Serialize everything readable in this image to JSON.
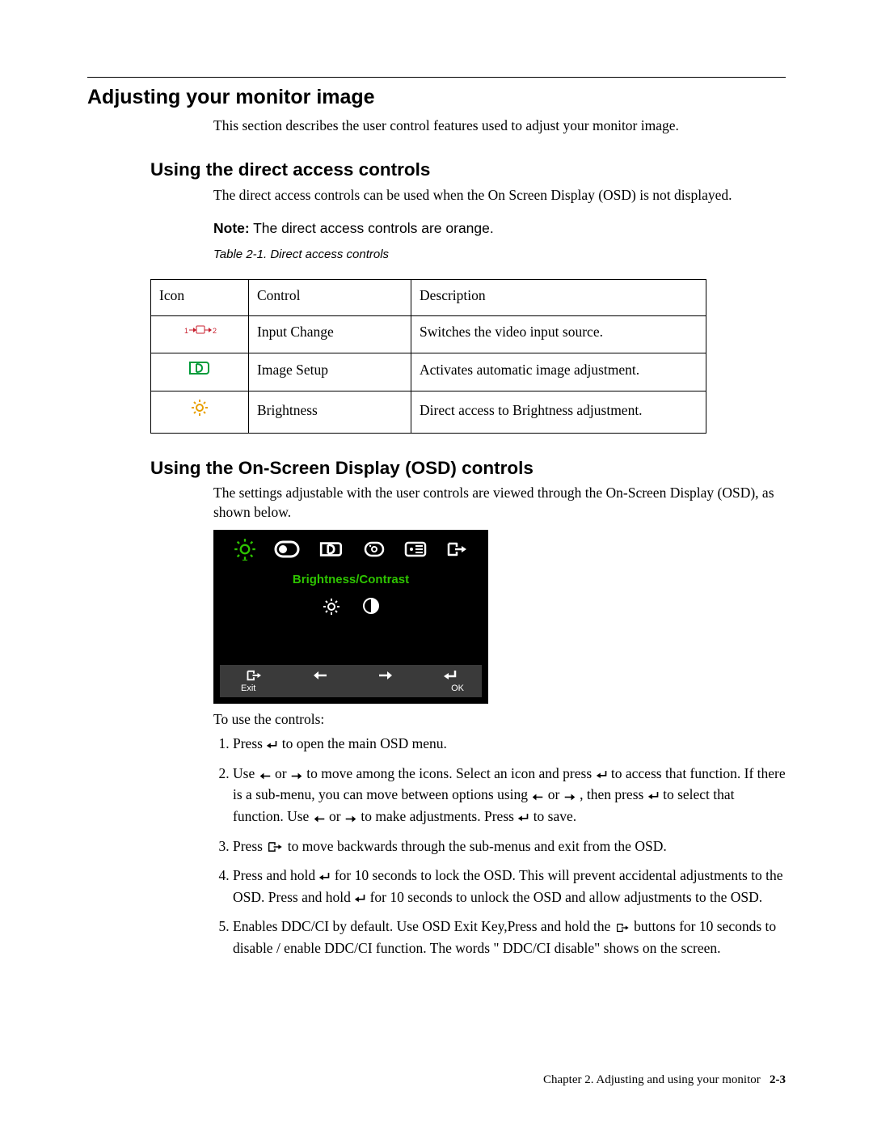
{
  "heading_main": "Adjusting your monitor image",
  "intro_main": "This section describes the user control features used to adjust your monitor image.",
  "heading_dac": "Using the direct access controls",
  "intro_dac": "The direct access controls can be used when the On Screen Display (OSD) is not displayed.",
  "note_label": "Note:",
  "note_text": "The direct access controls are orange.",
  "table_caption": "Table 2-1. Direct access controls",
  "dac_header": {
    "icon": "Icon",
    "control": "Control",
    "description": "Description"
  },
  "dac_rows": [
    {
      "control": "Input Change",
      "description": "Switches the video input source."
    },
    {
      "control": "Image Setup",
      "description": "Activates automatic image adjustment."
    },
    {
      "control": "Brightness",
      "description": "Direct access to Brightness adjustment."
    }
  ],
  "heading_osd": "Using the On-Screen Display (OSD) controls",
  "intro_osd": "The settings adjustable with the user controls are viewed through the On-Screen Display (OSD), as shown below.",
  "osd_title": "Brightness/Contrast",
  "osd_exit": "Exit",
  "osd_ok": "OK",
  "after_fig": "To use the controls:",
  "steps": {
    "s1a": "Press ",
    "s1b": " to open the main OSD menu.",
    "s2a": "Use ",
    "s2b": " or ",
    "s2c": " to move among the icons. Select an icon and press ",
    "s2d": " to access that function. If there is a sub-menu, you can move between options using ",
    "s2e": " or ",
    "s2f": " , then press ",
    "s2g": " to select that function. Use ",
    "s2h": " or ",
    "s2i": " to make adjustments. Press ",
    "s2j": " to save.",
    "s3a": "Press ",
    "s3b": " to move backwards through the sub-menus and exit from the OSD.",
    "s4a": "Press and hold ",
    "s4b": " for 10 seconds to lock the OSD. This will prevent accidental adjustments to the OSD. Press and hold ",
    "s4c": " for 10 seconds to unlock the OSD and allow adjustments to the OSD.",
    "s5a": "Enables DDC/CI by default. Use OSD Exit Key,Press and hold the ",
    "s5b": " buttons for 10 seconds to disable / enable DDC/CI function. The words \" DDC/CI disable\" shows on the screen."
  },
  "footer_chapter": "Chapter 2. Adjusting and using your monitor",
  "footer_page": "2-3"
}
